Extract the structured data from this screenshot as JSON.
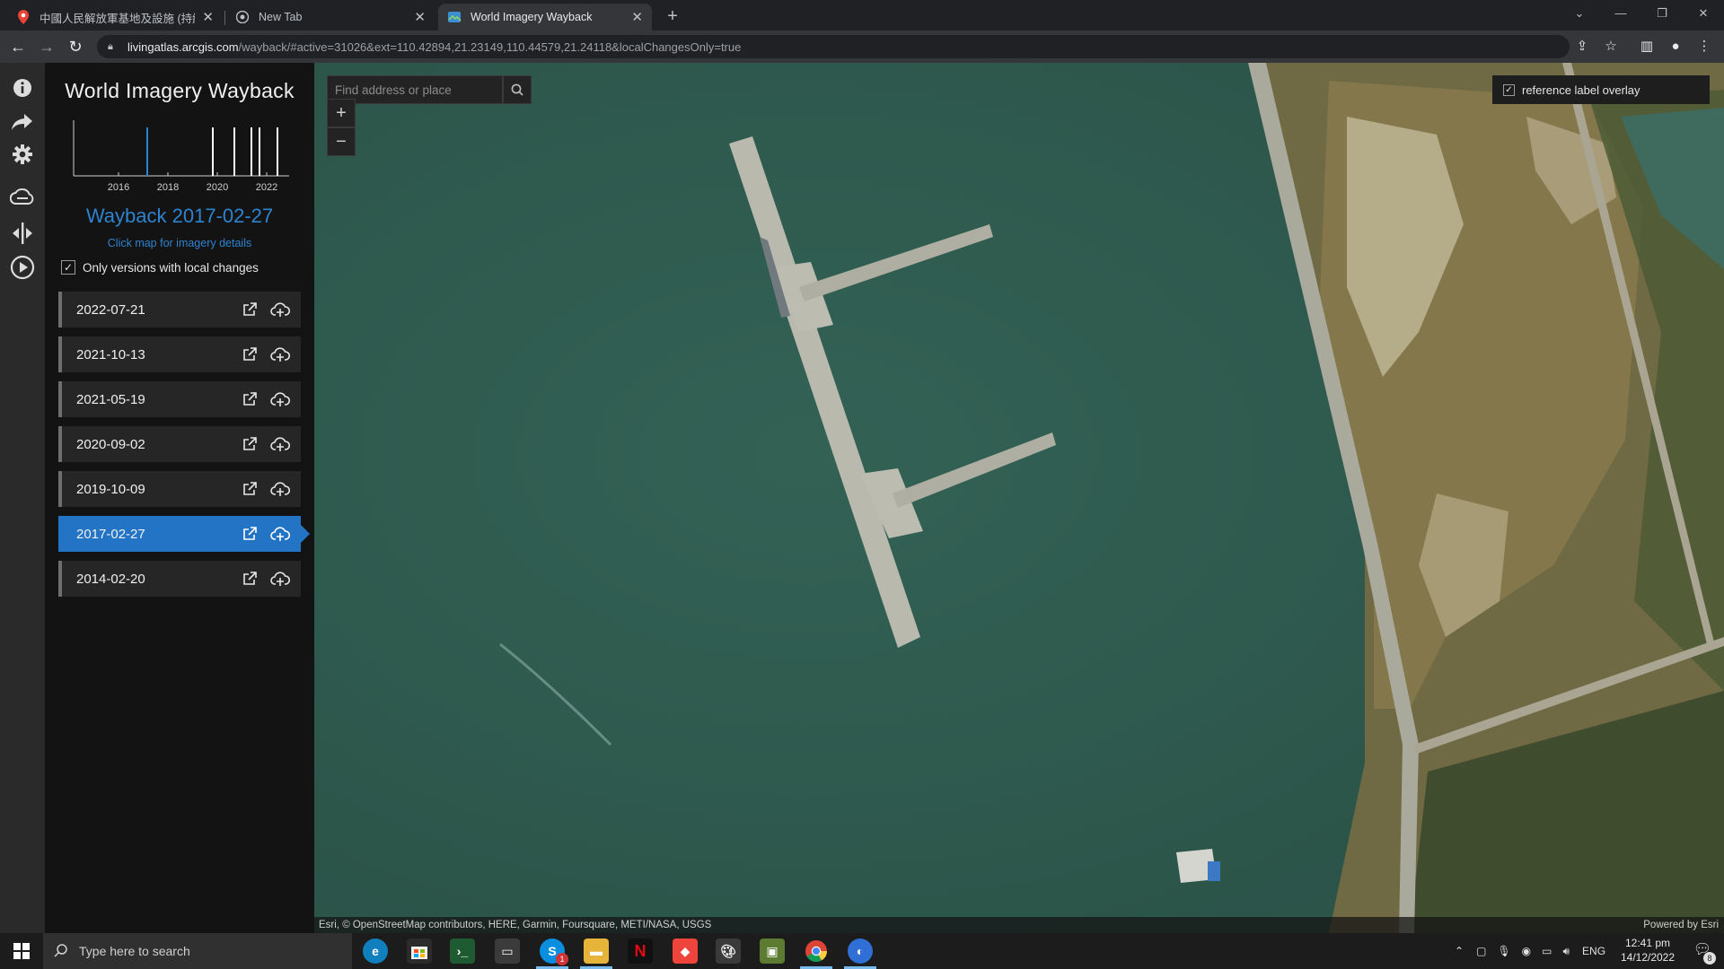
{
  "browser": {
    "tabs": [
      {
        "title": "中國人民解放軍基地及設施 (持續",
        "active": false
      },
      {
        "title": "New Tab",
        "active": false
      },
      {
        "title": "World Imagery Wayback",
        "active": true
      }
    ],
    "url_host": "livingatlas.arcgis.com",
    "url_path": "/wayback/#active=31026&ext=110.42894,21.23149,110.44579,21.24118&localChangesOnly=true"
  },
  "sidebar_rail": {
    "icons": [
      "info-icon",
      "share-icon",
      "settings-icon",
      "layers-icon",
      "swipe-icon",
      "play-icon"
    ]
  },
  "panel": {
    "app_title": "World Imagery Wayback",
    "timeline_ticks": [
      "2016",
      "2018",
      "2020",
      "2022"
    ],
    "wayback_title": "Wayback 2017-02-27",
    "click_hint": "Click map for imagery details",
    "local_changes_label": "Only versions with local changes",
    "local_changes_checked": true,
    "releases": [
      {
        "date": "2022-07-21",
        "selected": false
      },
      {
        "date": "2021-10-13",
        "selected": false
      },
      {
        "date": "2021-05-19",
        "selected": false
      },
      {
        "date": "2020-09-02",
        "selected": false
      },
      {
        "date": "2019-10-09",
        "selected": false
      },
      {
        "date": "2017-02-27",
        "selected": true
      },
      {
        "date": "2014-02-20",
        "selected": false
      }
    ]
  },
  "map": {
    "search_placeholder": "Find address or place",
    "zoom_in": "+",
    "zoom_out": "−",
    "overlay_label": "reference label overlay",
    "overlay_checked": true,
    "attribution": "Esri, © OpenStreetMap contributors, HERE, Garmin, Foursquare, METI/NASA, USGS",
    "powered_by": "Powered by Esri",
    "colors": {
      "water": "#2f5a4d",
      "pier": "#b7b8ae",
      "land": "#7d7649",
      "sand": "#c9c1a4"
    }
  },
  "taskbar": {
    "search_placeholder": "Type here to search",
    "apps": [
      "edge",
      "store",
      "terminal",
      "folder-dark",
      "skype",
      "file-explorer",
      "netflix",
      "anydesk",
      "paint",
      "minecraft",
      "chrome",
      "google-earth"
    ],
    "skype_badge": "1",
    "lang": "ENG",
    "time": "12:41 pm",
    "date": "14/12/2022",
    "notification_count": "8"
  }
}
